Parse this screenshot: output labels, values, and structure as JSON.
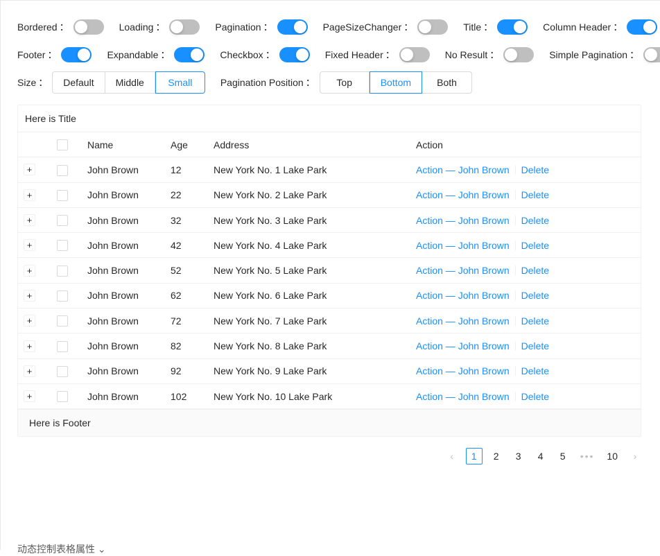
{
  "controls": {
    "row1": [
      {
        "label": "Bordered",
        "colon": "：",
        "state": "off",
        "name": "bordered"
      },
      {
        "label": "Loading",
        "colon": "：",
        "state": "off",
        "name": "loading"
      },
      {
        "label": "Pagination",
        "colon": "：",
        "state": "on",
        "name": "pagination"
      },
      {
        "label": "PageSizeChanger",
        "colon": "：",
        "state": "off",
        "name": "page-size-changer"
      },
      {
        "label": "Title",
        "colon": "：",
        "state": "on",
        "name": "title"
      },
      {
        "label": "Column Header",
        "colon": "：",
        "state": "on",
        "name": "column-header"
      }
    ],
    "row2": [
      {
        "label": "Footer",
        "colon": "：",
        "state": "on",
        "name": "footer"
      },
      {
        "label": "Expandable",
        "colon": "：",
        "state": "on",
        "name": "expandable"
      },
      {
        "label": "Checkbox",
        "colon": "：",
        "state": "on",
        "name": "checkbox"
      },
      {
        "label": "Fixed Header",
        "colon": "：",
        "state": "off",
        "name": "fixed-header"
      },
      {
        "label": "No Result",
        "colon": "：",
        "state": "off",
        "name": "no-result"
      },
      {
        "label": "Simple Pagination",
        "colon": "：",
        "state": "off",
        "name": "simple-pagination"
      }
    ],
    "size": {
      "label": "Size",
      "colon": "：",
      "options": [
        "Default",
        "Middle",
        "Small"
      ],
      "selected": "Small"
    },
    "pagination_position": {
      "label": "Pagination Position",
      "colon": "：",
      "options": [
        "Top",
        "Bottom",
        "Both"
      ],
      "selected": "Bottom"
    }
  },
  "table": {
    "title": "Here is Title",
    "footer": "Here is Footer",
    "expand_glyph": "+",
    "columns": [
      "Name",
      "Age",
      "Address",
      "Action"
    ],
    "action_separator": "|",
    "rows": [
      {
        "name": "John Brown",
        "age": "12",
        "address": "New York No. 1 Lake Park",
        "action": "Action — John Brown",
        "delete": "Delete"
      },
      {
        "name": "John Brown",
        "age": "22",
        "address": "New York No. 2 Lake Park",
        "action": "Action — John Brown",
        "delete": "Delete"
      },
      {
        "name": "John Brown",
        "age": "32",
        "address": "New York No. 3 Lake Park",
        "action": "Action — John Brown",
        "delete": "Delete"
      },
      {
        "name": "John Brown",
        "age": "42",
        "address": "New York No. 4 Lake Park",
        "action": "Action — John Brown",
        "delete": "Delete"
      },
      {
        "name": "John Brown",
        "age": "52",
        "address": "New York No. 5 Lake Park",
        "action": "Action — John Brown",
        "delete": "Delete"
      },
      {
        "name": "John Brown",
        "age": "62",
        "address": "New York No. 6 Lake Park",
        "action": "Action — John Brown",
        "delete": "Delete"
      },
      {
        "name": "John Brown",
        "age": "72",
        "address": "New York No. 7 Lake Park",
        "action": "Action — John Brown",
        "delete": "Delete"
      },
      {
        "name": "John Brown",
        "age": "82",
        "address": "New York No. 8 Lake Park",
        "action": "Action — John Brown",
        "delete": "Delete"
      },
      {
        "name": "John Brown",
        "age": "92",
        "address": "New York No. 9 Lake Park",
        "action": "Action — John Brown",
        "delete": "Delete"
      },
      {
        "name": "John Brown",
        "age": "102",
        "address": "New York No. 10 Lake Park",
        "action": "Action — John Brown",
        "delete": "Delete"
      }
    ]
  },
  "pagination": {
    "prev_glyph": "‹",
    "next_glyph": "›",
    "ellipsis": "•••",
    "pages": [
      "1",
      "2",
      "3",
      "4",
      "5"
    ],
    "last_page": "10",
    "current": "1"
  },
  "bottom_caption": "动态控制表格属性 ⌄",
  "colors": {
    "accent": "#1890ff",
    "switch_off": "#bfbfbf",
    "border": "#f0f0f0",
    "footer_bg": "#fafafa"
  }
}
